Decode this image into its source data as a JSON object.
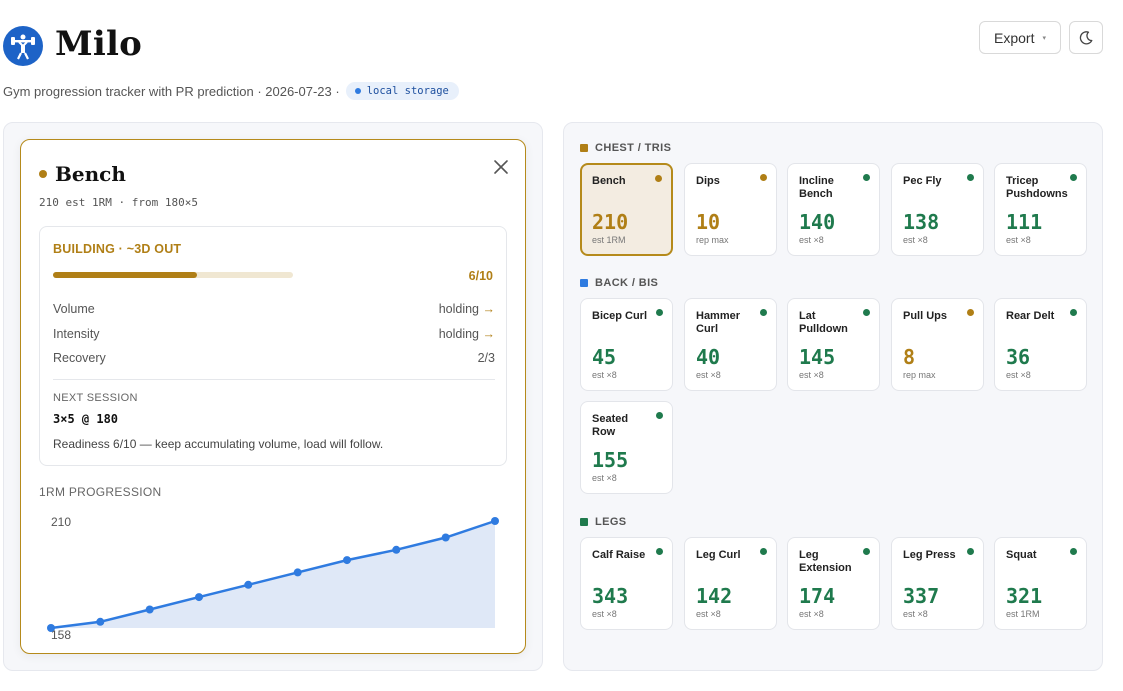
{
  "app": {
    "title": "Milo",
    "subtitle": "Gym progression tracker with PR prediction · 2026-07-23 ·",
    "storage_badge": "local storage"
  },
  "toolbar": {
    "export_label": "Export",
    "export_caret": "▾",
    "theme_icon": "moon-icon"
  },
  "colors": {
    "accent_gold": "#b07f16",
    "accent_green": "#1f7a4d",
    "accent_blue": "#2f7be0",
    "chest_tris": "#b07f16",
    "back_bis": "#2f7be0",
    "legs": "#1f7a4d"
  },
  "detail": {
    "title": "Bench",
    "meta": "210 est 1RM · from 180×5",
    "status": "BUILDING · ~3D OUT",
    "progress_value": 6,
    "progress_max": 10,
    "progress_label": "6/10",
    "metrics": [
      {
        "label": "Volume",
        "value": "holding",
        "arrow": "→"
      },
      {
        "label": "Intensity",
        "value": "holding",
        "arrow": "→"
      },
      {
        "label": "Recovery",
        "value": "2/3",
        "arrow": ""
      }
    ],
    "next_session_label": "NEXT SESSION",
    "next_session_value": "3×5 @ 180",
    "readiness_text": "Readiness 6/10 — keep accumulating volume, load will follow.",
    "progression_label": "1RM PROGRESSION"
  },
  "chart_data": {
    "type": "area",
    "title": "1RM PROGRESSION",
    "x": [
      1,
      2,
      3,
      4,
      5,
      6,
      7,
      8,
      9,
      10
    ],
    "values": [
      158,
      161,
      167,
      173,
      179,
      185,
      191,
      196,
      202,
      210
    ],
    "ylim": [
      158,
      210
    ],
    "y_labels": [
      "210",
      "158"
    ],
    "grid": false,
    "legend": "none"
  },
  "sections": [
    {
      "label": "CHEST / TRIS",
      "color": "#b07f16",
      "tiles": [
        {
          "name": "Bench",
          "value": "210",
          "sub": "est 1RM",
          "status": "gold",
          "selected": true
        },
        {
          "name": "Dips",
          "value": "10",
          "sub": "rep max",
          "status": "gold",
          "selected": false
        },
        {
          "name": "Incline Bench",
          "value": "140",
          "sub": "est ×8",
          "status": "green",
          "selected": false
        },
        {
          "name": "Pec Fly",
          "value": "138",
          "sub": "est ×8",
          "status": "green",
          "selected": false
        },
        {
          "name": "Tricep Pushdowns",
          "value": "111",
          "sub": "est ×8",
          "status": "green",
          "selected": false
        }
      ]
    },
    {
      "label": "BACK / BIS",
      "color": "#2f7be0",
      "tiles": [
        {
          "name": "Bicep Curl",
          "value": "45",
          "sub": "est ×8",
          "status": "green",
          "selected": false
        },
        {
          "name": "Hammer Curl",
          "value": "40",
          "sub": "est ×8",
          "status": "green",
          "selected": false
        },
        {
          "name": "Lat Pulldown",
          "value": "145",
          "sub": "est ×8",
          "status": "green",
          "selected": false
        },
        {
          "name": "Pull Ups",
          "value": "8",
          "sub": "rep max",
          "status": "gold",
          "selected": false
        },
        {
          "name": "Rear Delt",
          "value": "36",
          "sub": "est ×8",
          "status": "green",
          "selected": false
        },
        {
          "name": "Seated Row",
          "value": "155",
          "sub": "est ×8",
          "status": "green",
          "selected": false
        }
      ]
    },
    {
      "label": "LEGS",
      "color": "#1f7a4d",
      "tiles": [
        {
          "name": "Calf Raise",
          "value": "343",
          "sub": "est ×8",
          "status": "green",
          "selected": false
        },
        {
          "name": "Leg Curl",
          "value": "142",
          "sub": "est ×8",
          "status": "green",
          "selected": false
        },
        {
          "name": "Leg Extension",
          "value": "174",
          "sub": "est ×8",
          "status": "green",
          "selected": false
        },
        {
          "name": "Leg Press",
          "value": "337",
          "sub": "est ×8",
          "status": "green",
          "selected": false
        },
        {
          "name": "Squat",
          "value": "321",
          "sub": "est 1RM",
          "status": "green",
          "selected": false
        }
      ]
    }
  ]
}
